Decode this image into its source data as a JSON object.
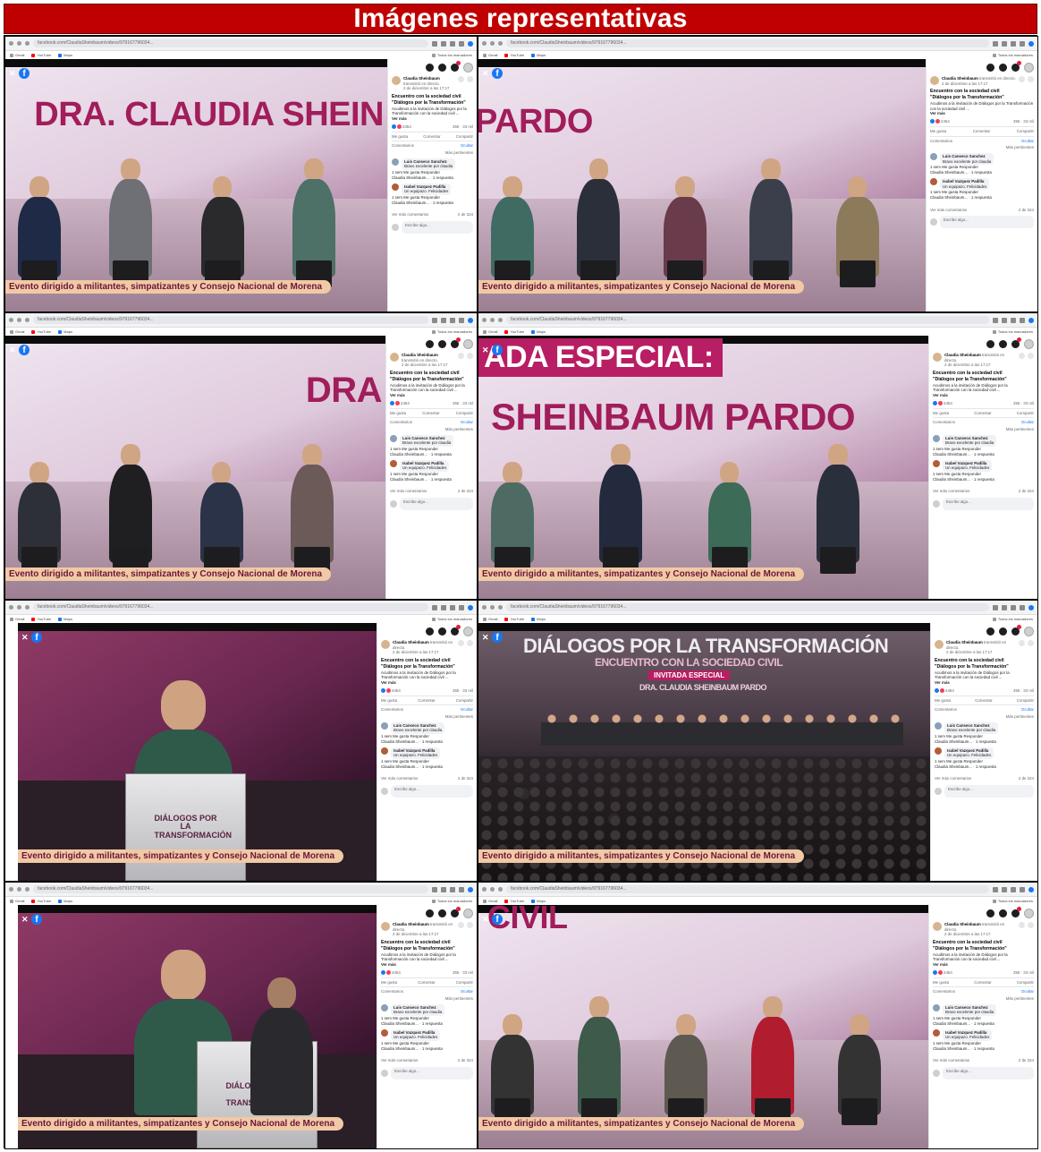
{
  "banner": {
    "title": "Imágenes representativas"
  },
  "browser": {
    "url": "facebook.com/ClaudiaSheinbaum/videos/979167796034...",
    "bookmarks": [
      "Gmail",
      "YouTube",
      "Maps"
    ],
    "bookmarks_right": "Todos los marcadores"
  },
  "caption": "Evento dirigido a militantes, simpatizantes y Consejo Nacional de Morena",
  "panel": {
    "author_name": "Claudia Sheinbaum",
    "author_status": "transmitió en directo.",
    "author_time": "2 de diciembre a las 17:17",
    "post_title_1": "Encuentro con la sociedad civil",
    "post_title_2": "\"Diálogos por la Transformación\"",
    "post_desc": "Acudimos a la invitación de Diálogos por la Transformación con la sociedad civil ...",
    "see_more": "Ver más",
    "reactions_count": "2454",
    "comments_count": "355",
    "views": "33 mil",
    "like": "Me gusta",
    "comment": "Comentar",
    "share": "Compartir",
    "comments_label": "Comentarios",
    "hide": "Ocultar",
    "most_relevant": "Más pertinentes",
    "comment1_name": "Luis Canseco Sanchez",
    "comment1_text": "Bravo excelente por claudia",
    "comment1_meta": "1 sem   Me gusta   Responder",
    "comment2_name": "Isabel Vazquez Padilla",
    "comment2_text": "Un equipazo. Felicidades",
    "comment2_meta": "1 sem   Me gusta   Responder",
    "reply_text": "Claudia Sheinbaum... · 1 respuesta",
    "see_more_comments": "Ver más comentarios",
    "pagination": "2 de 324",
    "write_placeholder": "Escribe algo..."
  },
  "frames": [
    {
      "sign": "DRA. CLAUDIA SHEIN"
    },
    {
      "sign": "PARDO"
    },
    {
      "sign": "DRA"
    },
    {
      "sign": "ADA ESPECIAL:",
      "sign2": "SHEINBAUM PARDO"
    },
    {
      "lectern": "DIÁLOGOS POR LA TRANSFORMACIÓN"
    },
    {
      "sign": "DIÁLOGOS POR LA TRANSFORMACIÓN",
      "sign2": "ENCUENTRO CON LA SOCIEDAD CIVIL",
      "sign3": "INVITADA ESPECIAL",
      "sign4": "DRA. CLAUDIA SHEINBAUM PARDO"
    },
    {
      "lectern": "DIÁLOGOS POR LA TRANSFORMACIÓN"
    },
    {
      "sign": "CIVIL"
    }
  ],
  "colors": {
    "banner": "#c00000",
    "caption_bg": "#f1c9a5",
    "caption_text": "#6b1638",
    "facebook": "#1877f2"
  }
}
